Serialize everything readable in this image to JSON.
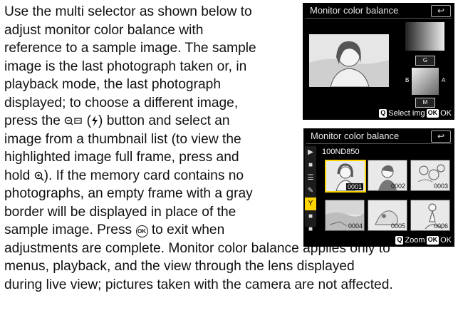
{
  "body_lines": [
    "Use the multi selector as shown below to",
    "adjust monitor color balance with",
    "reference to a sample image. The sample",
    "image is the last photograph taken or, in",
    "playback mode, the last photograph",
    "displayed; to choose a different image,",
    "press the",
    "button and select an",
    "image from a thumbnail list (to view the",
    "highlighted image full frame, press and",
    "hold",
    "). If the memory card contains no",
    "photographs, an empty frame with a gray",
    "border will be displayed in place of the",
    "sample image. Press",
    "to exit when",
    "adjustments are complete. Monitor color balance applies only to",
    "menus, playback, and the view through the lens displayed",
    "during live view; pictures taken with the camera are not affected."
  ],
  "icons": {
    "thumb_button": "magnify-minus-thumbnail-icon",
    "flash_paren": "(",
    "flash_icon": "flash-icon",
    "flash_paren_close": ")",
    "zoom_in": "magnify-plus-icon",
    "ok": "OK"
  },
  "screen1": {
    "title": "Monitor color balance",
    "back": "↩",
    "btn_g": "G",
    "btn_m": "M",
    "label_b": "B",
    "label_a": "A",
    "footer_key": "Q",
    "footer_text": "Select img",
    "footer_ok": "OK",
    "footer_ok_text": "OK"
  },
  "screen2": {
    "title": "Monitor color balance",
    "back": "↩",
    "folder": "100ND850",
    "tabs": [
      "▶",
      "■",
      "☰",
      "✎",
      "Y",
      "■",
      "■"
    ],
    "thumbs": [
      "0001",
      "0002",
      "0003",
      "0004",
      "0005",
      "0006"
    ],
    "footer_key": "Q",
    "footer_text": "Zoom",
    "footer_ok": "OK",
    "footer_ok_text": "OK"
  }
}
